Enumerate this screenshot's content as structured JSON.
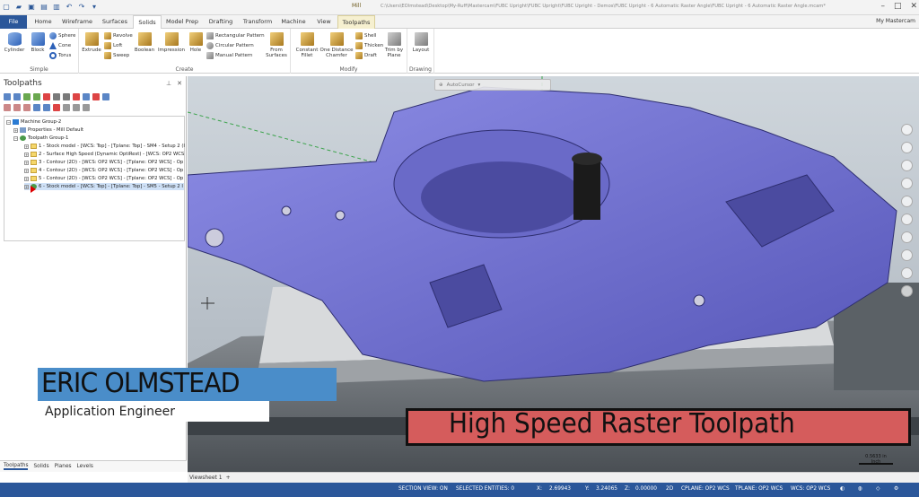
{
  "window": {
    "context_label": "Mill",
    "path": "C:\\Users\\EOlmstead\\Desktop\\My-Ruff\\Mastercam\\FUBC Upright\\FUBC Upright\\FUBC Upright - Demos\\FUBC Upright - 6 Automatic Raster Angle\\FUBC Upright - 6 Automatic Raster Angle.mcam*",
    "my_mastercam": "My Mastercam"
  },
  "tabs": [
    {
      "label": "File"
    },
    {
      "label": "Home"
    },
    {
      "label": "Wireframe"
    },
    {
      "label": "Surfaces"
    },
    {
      "label": "Solids"
    },
    {
      "label": "Model Prep"
    },
    {
      "label": "Drafting"
    },
    {
      "label": "Transform"
    },
    {
      "label": "Machine"
    },
    {
      "label": "View"
    },
    {
      "label": "Toolpaths"
    }
  ],
  "ribbon": {
    "simple": {
      "label": "Simple",
      "cylinder": "Cylinder",
      "block": "Block",
      "sphere": "Sphere",
      "cone": "Cone",
      "torus": "Torus"
    },
    "create": {
      "label": "Create",
      "extrude": "Extrude",
      "revolve": "Revolve",
      "loft": "Loft",
      "sweep": "Sweep",
      "boolean": "Boolean",
      "impression": "Impression",
      "hole": "Hole",
      "rect_pattern": "Rectangular Pattern",
      "circ_pattern": "Circular Pattern",
      "manual_pattern": "Manual Pattern",
      "from_surfaces_1": "From",
      "from_surfaces_2": "Surfaces"
    },
    "modify": {
      "label": "Modify",
      "cfillet_1": "Constant",
      "cfillet_2": "Fillet",
      "chamfer_1": "One Distance",
      "chamfer_2": "Chamfer",
      "shell": "Shell",
      "thicken": "Thicken",
      "draft": "Draft",
      "trim_1": "Trim by",
      "trim_2": "Plane"
    },
    "drawing": {
      "label": "Drawing",
      "layout": "Layout"
    }
  },
  "left_panel": {
    "title": "Toolpaths",
    "tree": [
      {
        "text": "Machine Group-2"
      },
      {
        "text": "Properties - Mill Default"
      },
      {
        "text": "Toolpath Group-1"
      },
      {
        "text": "1 - Stock model - [WCS: Top] - [Tplane: Top] - SM4 - Setup 2 (I"
      },
      {
        "text": "2 - Surface High Speed (Dynamic OptiRest) - [WCS: OP2 WCS"
      },
      {
        "text": "3 - Contour (2D) - [WCS: OP2 WCS] - [Tplane: OP2 WCS] - Op"
      },
      {
        "text": "4 - Contour (2D) - [WCS: OP2 WCS] - [Tplane: OP2 WCS] - Op"
      },
      {
        "text": "5 - Contour (2D) - [WCS: OP2 WCS] - [Tplane: OP2 WCS] - Op"
      },
      {
        "text": "6 - Stock model - [WCS: Top] - [Tplane: Top] - SM5 - Setup 2 I"
      }
    ],
    "bottom_tabs": [
      "Toolpaths",
      "Solids",
      "Planes",
      "Levels"
    ]
  },
  "viewport": {
    "autocursor": "AutoCursor",
    "viewsheet": "Viewsheet 1",
    "scale_value": "0.5633 in",
    "scale_unit": "Inch"
  },
  "overlay": {
    "name": "ERIC OLMSTEAD",
    "role": "Application Engineer",
    "title": "High Speed Raster Toolpath"
  },
  "status": {
    "section_view": "SECTION VIEW: ON",
    "selected": "SELECTED ENTITIES: 0",
    "x_label": "X:",
    "x": "2.69943",
    "y_label": "Y:",
    "y": "3.24065",
    "z_label": "Z:",
    "z": "0.00000",
    "mode": "2D",
    "cplane": "CPLANE: OP2 WCS",
    "tplane": "TPLANE: OP2 WCS",
    "wcs": "WCS: OP2 WCS"
  },
  "colors": {
    "part": "#6f6fd2",
    "status_bg": "#2b579a",
    "banner_blue": "#4a8dc9",
    "banner_red": "#d55c5c"
  }
}
